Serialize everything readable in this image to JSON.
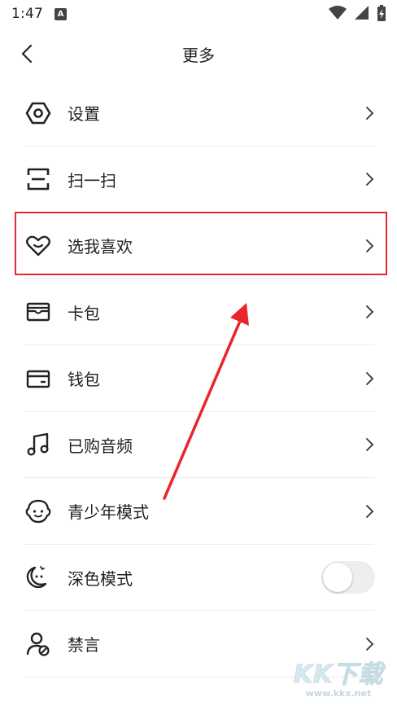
{
  "status_bar": {
    "time": "1:47",
    "app_icon_letter": "A"
  },
  "header": {
    "title": "更多"
  },
  "menu": {
    "items": [
      {
        "label": "设置",
        "icon": "hexagon-settings-icon"
      },
      {
        "label": "扫一扫",
        "icon": "scan-icon"
      },
      {
        "label": "选我喜欢",
        "icon": "heart-icon"
      },
      {
        "label": "卡包",
        "icon": "card-wallet-icon"
      },
      {
        "label": "钱包",
        "icon": "wallet-icon"
      },
      {
        "label": "已购音频",
        "icon": "music-note-icon"
      },
      {
        "label": "青少年模式",
        "icon": "child-face-icon"
      },
      {
        "label": "深色模式",
        "icon": "moon-icon"
      },
      {
        "label": "禁言",
        "icon": "mute-user-icon"
      }
    ],
    "dark_mode_enabled": false
  },
  "annotation": {
    "highlight_color": "#e02a2e",
    "arrow_color": "#e8262d"
  },
  "watermark": {
    "logo": "KK下载",
    "url": "www.kkx.net"
  }
}
